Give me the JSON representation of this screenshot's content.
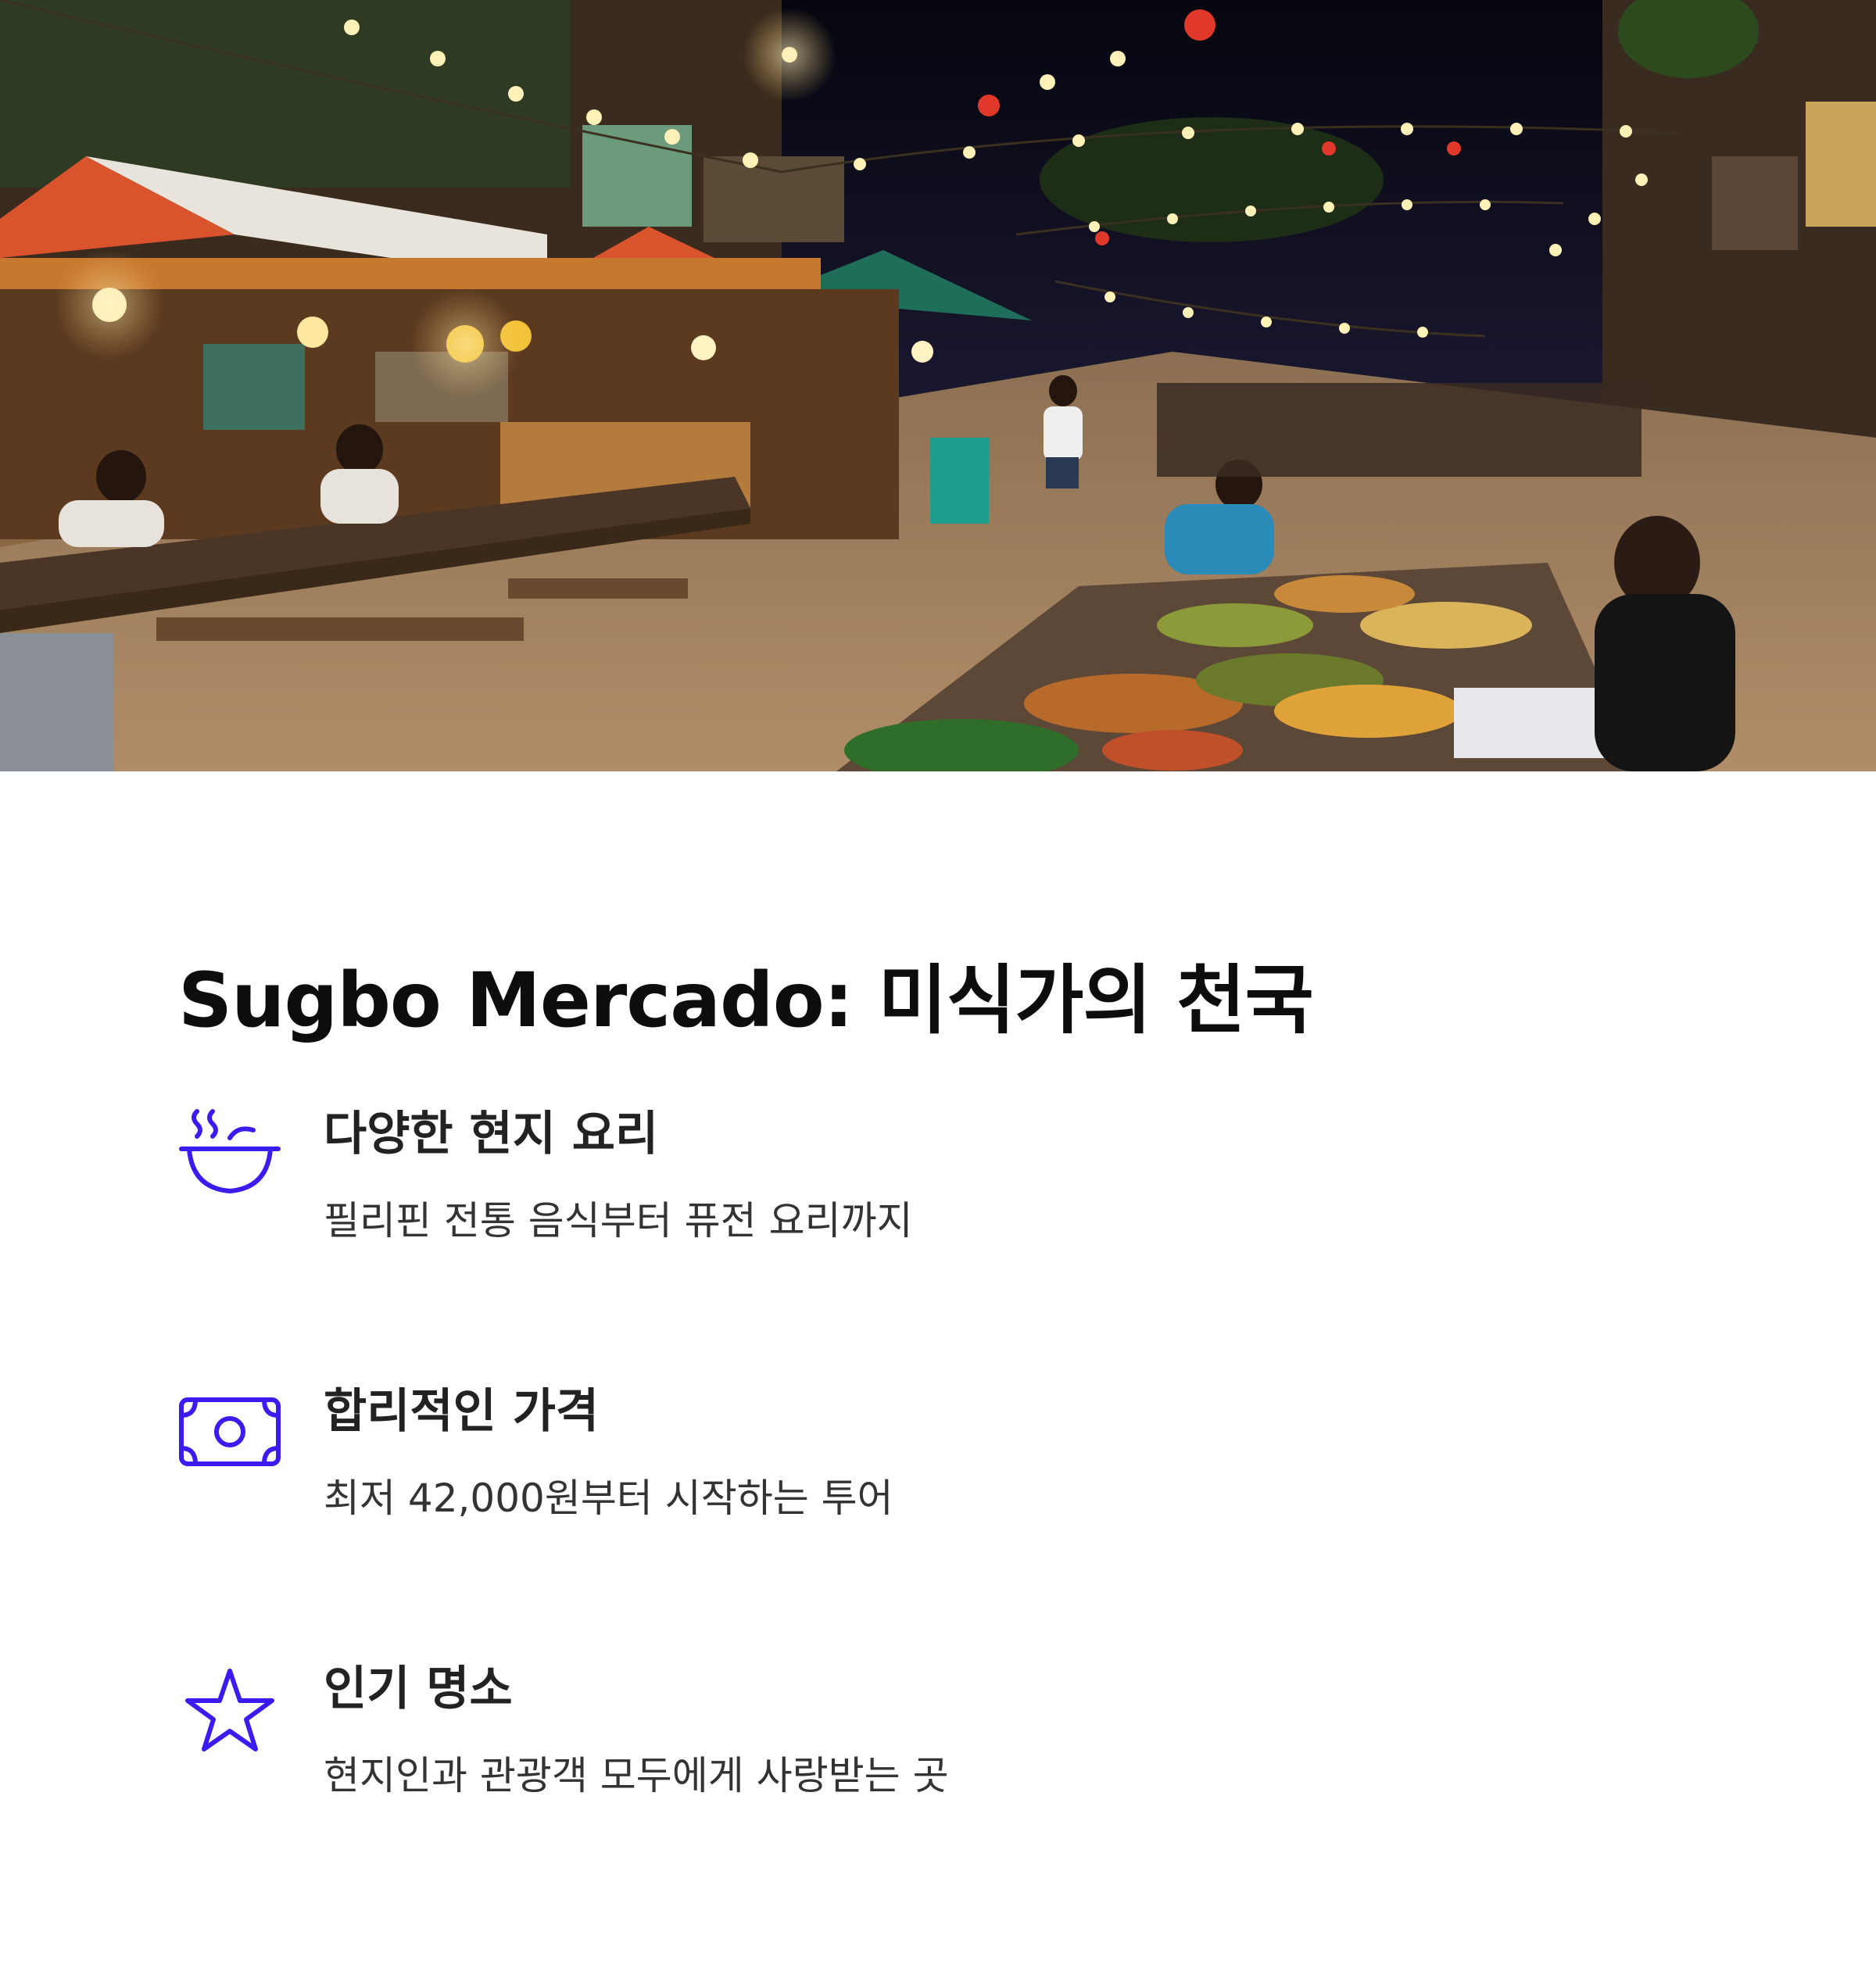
{
  "hero": {
    "image_alt": "night food market with string lights, stalls and diners",
    "accent_colors": [
      "#e0502a",
      "#1f6e5a",
      "#f3c56a"
    ]
  },
  "page": {
    "title": "Sugbo Mercado: 미식가의 천국"
  },
  "features": [
    {
      "icon": "bowl-icon",
      "title": "다양한 현지 요리",
      "description": "필리핀 전통 음식부터 퓨전 요리까지"
    },
    {
      "icon": "money-icon",
      "title": "합리적인 가격",
      "description": "최저 42,000원부터 시작하는 투어"
    },
    {
      "icon": "star-icon",
      "title": "인기 명소",
      "description": "현지인과 관광객 모두에게 사랑받는 곳"
    }
  ],
  "colors": {
    "icon_accent": "#3a1cf0",
    "text_primary": "#0d0d0d",
    "text_secondary": "#333333"
  }
}
